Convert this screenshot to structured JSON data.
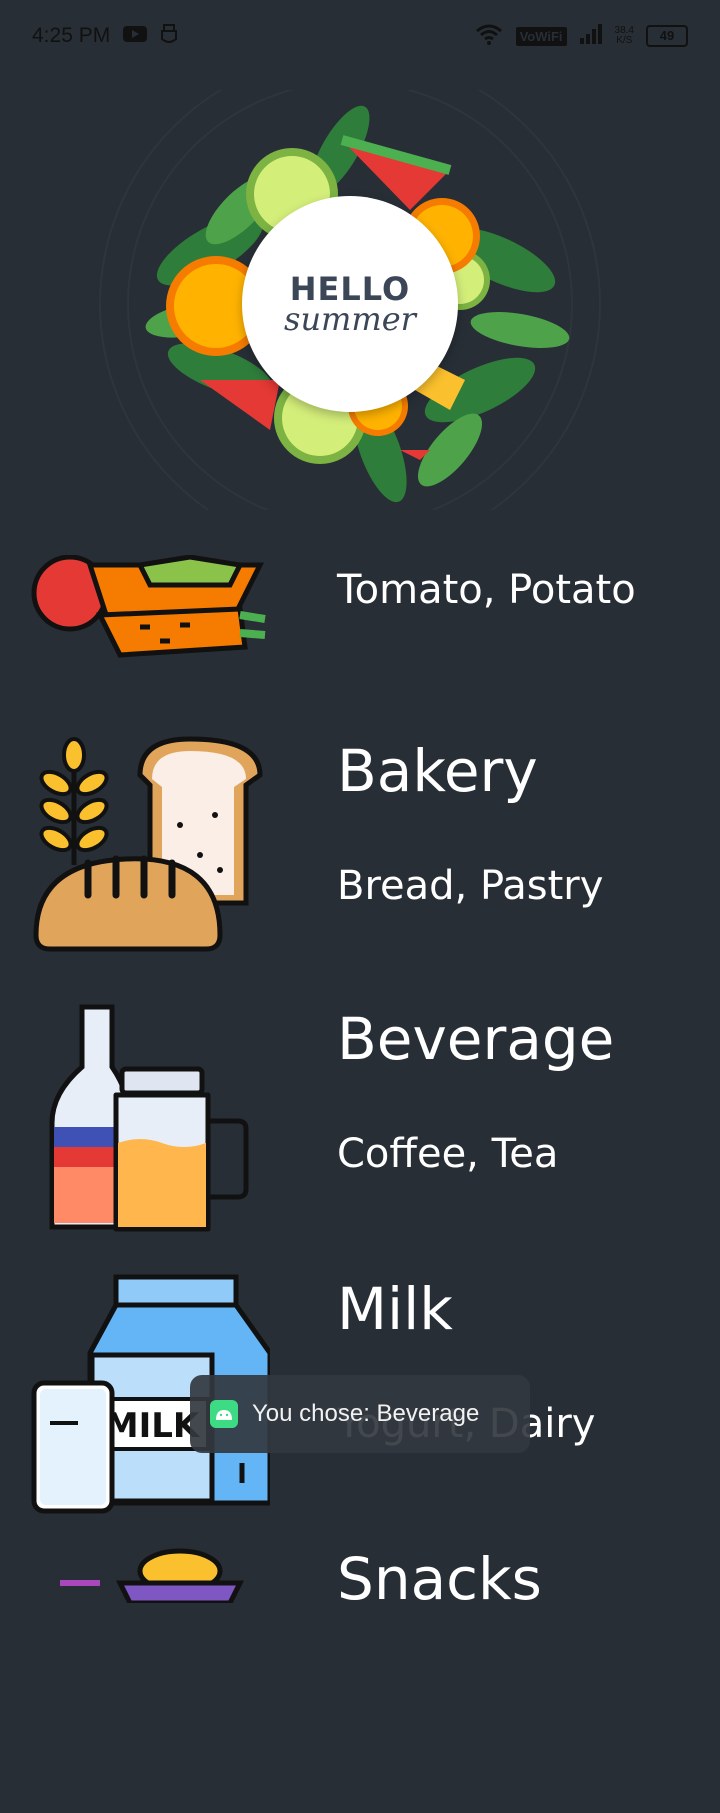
{
  "status_bar": {
    "time": "4:25 PM",
    "network_badge": "VoWiFi",
    "speed_value": "38.4",
    "speed_unit": "K/S",
    "battery": "49"
  },
  "banner": {
    "line1": "HELLO",
    "line2": "summer"
  },
  "categories": [
    {
      "title": "",
      "subtitle": "Tomato, Potato",
      "icon": "vegetables-icon"
    },
    {
      "title": "Bakery",
      "subtitle": "Bread, Pastry",
      "icon": "bakery-icon"
    },
    {
      "title": "Beverage",
      "subtitle": "Coffee, Tea",
      "icon": "beverage-icon"
    },
    {
      "title": "Milk",
      "subtitle": "Yogurt, Dairy",
      "icon": "milk-icon"
    },
    {
      "title": "Snacks",
      "subtitle": "",
      "icon": "snacks-icon"
    }
  ],
  "toast": {
    "message": "You chose: Beverage"
  },
  "colors": {
    "background": "#272e35",
    "text": "#ffffff"
  }
}
